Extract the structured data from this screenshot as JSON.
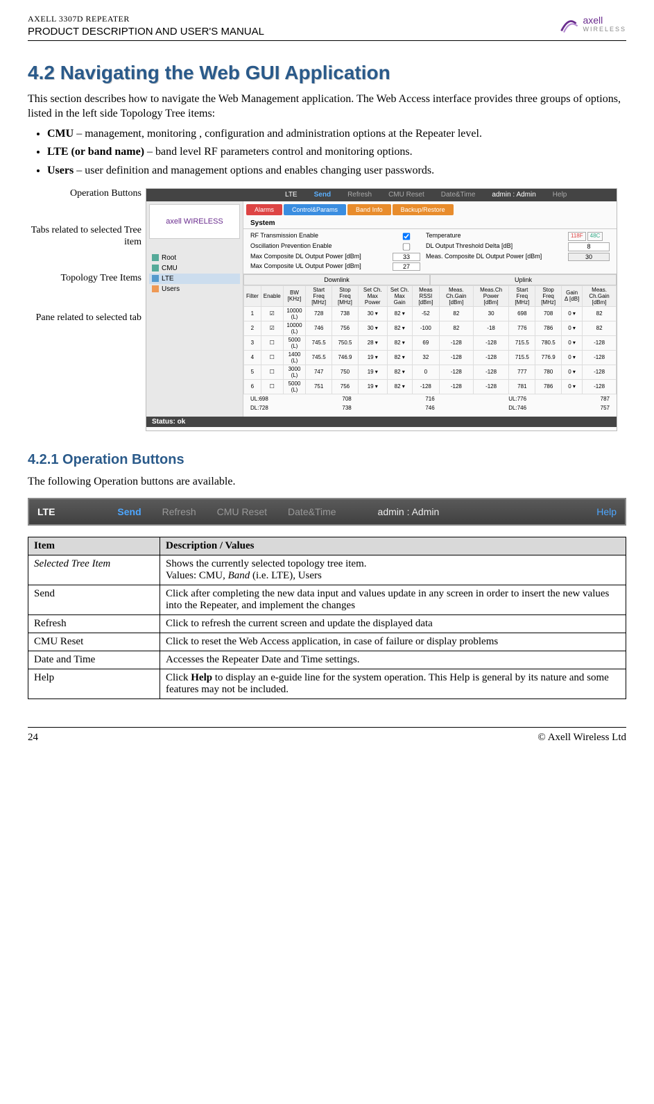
{
  "header": {
    "product_line": "AXELL 3307D REPEATER",
    "doc_title": "PRODUCT DESCRIPTION AND USER'S MANUAL",
    "logo_main": "axell",
    "logo_sub": "WIRELESS"
  },
  "section": {
    "num_title": "4.2   Navigating the Web GUI Application",
    "intro": "This section describes how to navigate the Web Management application. The Web Access interface provides three groups of options, listed in the left side Topology Tree items:",
    "bullets": [
      {
        "bold": "CMU",
        "rest": " –  management, monitoring , configuration and administration options at the Repeater level."
      },
      {
        "bold": "LTE (or band name)",
        "rest": " – band level RF parameters control and monitoring options."
      },
      {
        "bold": "Users",
        "rest": " – user definition and management options and enables changing user passwords."
      }
    ]
  },
  "annotations": {
    "a1": "Operation Buttons",
    "a2": "Tabs related to selected Tree item",
    "a3": "Topology Tree Items",
    "a4": "Pane related to selected tab"
  },
  "screenshot": {
    "topbar": {
      "lte": "LTE",
      "send": "Send",
      "refresh": "Refresh",
      "cmu": "CMU Reset",
      "dt": "Date&Time",
      "admin": "admin : Admin",
      "help": "Help"
    },
    "side_logo": "axell WIRELESS",
    "tree": {
      "root": "Root",
      "cmu": "CMU",
      "lte": "LTE",
      "users": "Users"
    },
    "tabs": {
      "alarms": "Alarms",
      "cp": "Control&Params",
      "bi": "Band Info",
      "br": "Backup/Restore"
    },
    "system_label": "System",
    "params": {
      "rf_en": "RF Transmission Enable",
      "osc": "Oscillation Prevention Enable",
      "max_dl": "Max Composite DL Output Power [dBm]",
      "max_ul": "Max Composite UL Output Power [dBm]",
      "temp": "Temperature",
      "dl_delta": "DL Output Threshold Delta [dB]",
      "meas_dl": "Meas. Composite DL Output Power [dBm]",
      "v33": "33",
      "v27": "27",
      "v8": "8",
      "v30": "30",
      "tf": "118F",
      "tc": "48C"
    },
    "dlul": {
      "dl": "Downlink",
      "ul": "Uplink"
    },
    "ch_headers": [
      "Filter",
      "Enable",
      "BW [KHz]",
      "Start Freq [MHz]",
      "Stop Freq [MHz]",
      "Set Ch. Max Power",
      "Set Ch. Max Gain",
      "Meas RSSI [dBm]",
      "Meas. Ch.Gain [dBm]",
      "Meas.Ch Power [dBm]",
      "Start Freq [MHz]",
      "Stop Freq [MHz]",
      "Gain Δ [dB]",
      "Meas. Ch.Gain [dBm]"
    ],
    "ch_rows": [
      [
        "1",
        "☑",
        "10000 (L)",
        "728",
        "738",
        "30 ▾",
        "82 ▾",
        "-52",
        "82",
        "30",
        "698",
        "708",
        "0 ▾",
        "82"
      ],
      [
        "2",
        "☑",
        "10000 (L)",
        "746",
        "756",
        "30 ▾",
        "82 ▾",
        "-100",
        "82",
        "-18",
        "776",
        "786",
        "0 ▾",
        "82"
      ],
      [
        "3",
        "☐",
        "5000 (L)",
        "745.5",
        "750.5",
        "28 ▾",
        "82 ▾",
        "69",
        "-128",
        "-128",
        "715.5",
        "780.5",
        "0 ▾",
        "-128"
      ],
      [
        "4",
        "☐",
        "1400 (L)",
        "745.5",
        "746.9",
        "19 ▾",
        "82 ▾",
        "32",
        "-128",
        "-128",
        "715.5",
        "776.9",
        "0 ▾",
        "-128"
      ],
      [
        "5",
        "☐",
        "3000 (L)",
        "747",
        "750",
        "19 ▾",
        "82 ▾",
        "0",
        "-128",
        "-128",
        "777",
        "780",
        "0 ▾",
        "-128"
      ],
      [
        "6",
        "☐",
        "5000 (L)",
        "751",
        "756",
        "19 ▾",
        "82 ▾",
        "-128",
        "-128",
        "-128",
        "781",
        "786",
        "0 ▾",
        "-128"
      ]
    ],
    "freq_labels": {
      "ul1": "UL:698",
      "ul2": "708",
      "ul3": "716",
      "ul4": "UL:776",
      "ul5": "787",
      "dl1": "DL:728",
      "dl2": "738",
      "dl3": "746",
      "dl4": "DL:746",
      "dl5": "757"
    },
    "status": "Status: ok"
  },
  "subsection": {
    "title": "4.2.1   Operation Buttons",
    "intro": "The following Operation buttons are available."
  },
  "opbar": {
    "lte": "LTE",
    "send": "Send",
    "refresh": "Refresh",
    "cmu": "CMU Reset",
    "dt": "Date&Time",
    "admin": "admin : Admin",
    "help": "Help"
  },
  "table": {
    "h1": "Item",
    "h2": "Description / Values",
    "rows": [
      {
        "item": "Selected Tree Item",
        "italic": true,
        "desc_html": "Shows the currently selected topology tree item.\nValues: CMU, <i>Band</i> (i.e. LTE), Users"
      },
      {
        "item": "Send",
        "desc_html": "Click after completing the new data input and values update in any screen in order to insert the new values into the Repeater, and implement the changes"
      },
      {
        "item": "Refresh",
        "desc_html": "Click to refresh the current screen and update the displayed data"
      },
      {
        "item": "CMU Reset",
        "desc_html": "Click to reset the Web Access application, in case of failure or display problems"
      },
      {
        "item": "Date and Time",
        "desc_html": "Accesses the Repeater Date and Time settings."
      },
      {
        "item": "Help",
        "desc_html": "Click <b>Help</b> to display an e-guide line for the system operation.  This Help is general by its nature and some features may not be included."
      }
    ]
  },
  "footer": {
    "page": "24",
    "copy": "© Axell Wireless Ltd"
  }
}
